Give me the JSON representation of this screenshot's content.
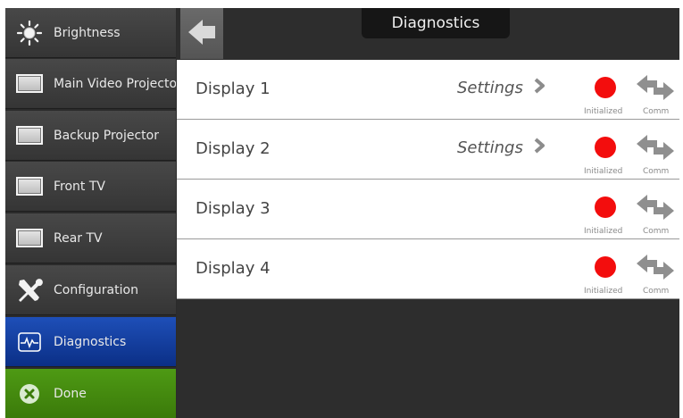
{
  "sidebar": {
    "items": [
      {
        "label": "Brightness",
        "icon": "sun-icon"
      },
      {
        "label": "Main Video Projector",
        "icon": "display-icon"
      },
      {
        "label": "Backup Projector",
        "icon": "display-icon"
      },
      {
        "label": "Front TV",
        "icon": "display-icon"
      },
      {
        "label": "Rear TV",
        "icon": "display-icon"
      },
      {
        "label": "Configuration",
        "icon": "tools-icon"
      },
      {
        "label": "Diagnostics",
        "icon": "waveform-icon",
        "active": true
      },
      {
        "label": "Done",
        "icon": "close-circle-icon"
      }
    ]
  },
  "header": {
    "title": "Diagnostics",
    "back_icon": "arrow-left-icon"
  },
  "displays": [
    {
      "name": "Display 1",
      "settings": "Settings",
      "status_label": "Initialized",
      "comm_label": "Comm"
    },
    {
      "name": "Display 2",
      "settings": "Settings",
      "status_label": "Initialized",
      "comm_label": "Comm"
    },
    {
      "name": "Display 3",
      "status_label": "Initialized",
      "comm_label": "Comm"
    },
    {
      "name": "Display 4",
      "status_label": "Initialized",
      "comm_label": "Comm"
    }
  ],
  "colors": {
    "active": "#0b2f86",
    "done": "#3b7a0a",
    "status_red": "#f30d0d"
  }
}
